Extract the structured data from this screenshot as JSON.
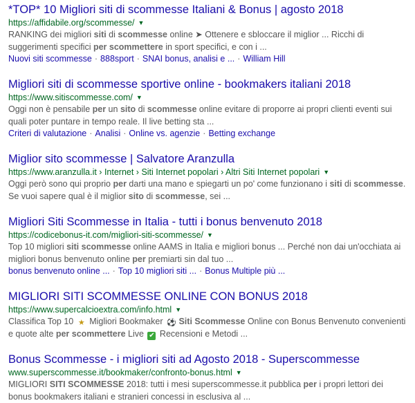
{
  "results": [
    {
      "title": "*TOP* 10 Migliori siti di scommesse Italiani & Bonus | agosto 2018",
      "url": "https://affidabile.org/scommesse/",
      "snippet_lines": [
        [
          "RANKING dei migliori ",
          {
            "b": "siti"
          },
          " di ",
          {
            "b": "scommesse"
          },
          " online ➤ Ottenere e sbloccare il miglior ... Ricchi di"
        ],
        [
          "suggerimenti specifici ",
          {
            "b": "per scommettere"
          },
          " in sport specifici, e con i ..."
        ]
      ],
      "sitelinks": [
        "Nuovi siti scommesse",
        "888sport",
        "SNAI bonus, analisi e ...",
        "William Hill"
      ]
    },
    {
      "title": "Migliori siti di scommesse sportive online - bookmakers italiani 2018",
      "url": "https://www.sitiscommesse.com/",
      "snippet_lines": [
        [
          "Oggi non è pensabile ",
          {
            "b": "per"
          },
          " un ",
          {
            "b": "sito"
          },
          " di ",
          {
            "b": "scommesse"
          },
          " online evitare di proporre ai propri clienti eventi sui"
        ],
        [
          "quali poter puntare in tempo reale. Il live betting sta ..."
        ]
      ],
      "sitelinks": [
        "Criteri di valutazione",
        "Analisi",
        "Online vs. agenzie",
        "Betting exchange"
      ]
    },
    {
      "title": "Miglior sito scommesse | Salvatore Aranzulla",
      "url": "https://www.aranzulla.it › Internet › Siti Internet popolari › Altri Siti Internet popolari",
      "snippet_lines": [
        [
          "Oggi però sono qui proprio ",
          {
            "b": "per"
          },
          " darti una mano e spiegarti un po' come funzionano i ",
          {
            "b": "siti"
          },
          " di ",
          {
            "b": "scommesse"
          },
          "."
        ],
        [
          "Se vuoi sapere qual è il miglior ",
          {
            "b": "sito"
          },
          " di ",
          {
            "b": "scommesse"
          },
          ", sei ..."
        ]
      ],
      "sitelinks": []
    },
    {
      "title": "Migliori Siti Scommesse in Italia - tutti i bonus benvenuto 2018",
      "url": "https://codicebonus-it.com/migliori-siti-scommesse/",
      "snippet_lines": [
        [
          "Top 10 migliori ",
          {
            "b": "siti scommesse"
          },
          " online AAMS in Italia e migliori bonus ... Perché non dai un'occhiata ai"
        ],
        [
          "migliori bonus benvenuto online ",
          {
            "b": "per"
          },
          " premiarti sin dal tuo ..."
        ]
      ],
      "sitelinks": [
        "bonus benvenuto online ...",
        "Top 10 migliori siti ...",
        "Bonus Multiple più ..."
      ]
    },
    {
      "title": "MIGLIORI SITI SCOMMESSE ONLINE CON BONUS 2018",
      "url": "https://www.supercalcioextra.com/info.html",
      "snippet_lines": [
        [
          "Classifica Top 10 ",
          {
            "icon": "star"
          },
          " Migliori Bookmaker ",
          {
            "icon": "ball"
          },
          " ",
          {
            "b": "Siti Scommesse"
          },
          " Online con Bonus Benvenuto convenienti"
        ],
        [
          "e quote alte ",
          {
            "b": "per scommettere"
          },
          " Live ",
          {
            "icon": "check"
          },
          " Recensioni e Metodi ..."
        ]
      ],
      "sitelinks": []
    },
    {
      "title": "Bonus Scommesse - i migliori siti ad Agosto 2018 - Superscommesse",
      "url": "www.superscommesse.it/bookmaker/confronto-bonus.html",
      "snippet_lines": [
        [
          "MIGLIORI ",
          {
            "b": "SITI SCOMMESSE"
          },
          " 2018: tutti i mesi superscommesse.it pubblica ",
          {
            "b": "per"
          },
          " i propri lettori dei"
        ],
        [
          "bonus bookmakers italiani e stranieri concessi in esclusiva al ..."
        ]
      ],
      "sitelinks": []
    }
  ],
  "icons": {
    "dropdown": "▼",
    "star": "★",
    "ball": "⚽",
    "check": "✔"
  },
  "colors": {
    "title": "#1a0dab",
    "url": "#006621",
    "snippet": "#545454"
  }
}
